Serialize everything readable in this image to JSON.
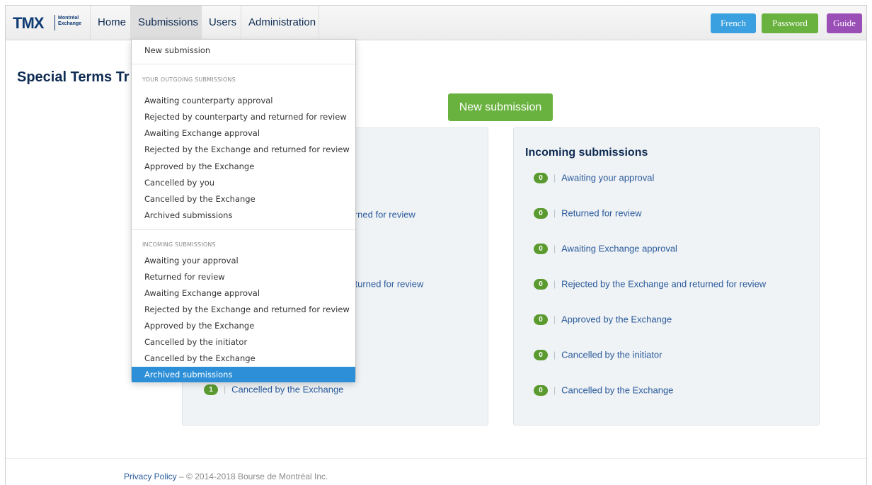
{
  "brand": {
    "logo_text": "TMX",
    "sub_line1": "Montréal",
    "sub_line2": "Exchange"
  },
  "nav": {
    "home": "Home",
    "submissions": "Submissions",
    "users": "Users",
    "administration": "Administration"
  },
  "top_buttons": {
    "french": "French",
    "password": "Password",
    "guide": "Guide"
  },
  "colors": {
    "primary_blue": "#0e2b52",
    "green": "#6ab23f",
    "french": "#3aa0e0",
    "guide": "#9a4fb6",
    "highlight": "#2d8fd8"
  },
  "page": {
    "title": "Special Terms Tr",
    "new_submission_button": "New submission"
  },
  "left_panel": {
    "rows": [
      {
        "label": "turned for review"
      },
      {
        "label": "returned for review"
      },
      {
        "badge": "1",
        "label": "Cancelled by the Exchange"
      }
    ]
  },
  "right_panel": {
    "title": "Incoming submissions",
    "rows": [
      {
        "badge": "0",
        "label": "Awaiting your approval"
      },
      {
        "badge": "0",
        "label": "Returned for review"
      },
      {
        "badge": "0",
        "label": "Awaiting Exchange approval"
      },
      {
        "badge": "0",
        "label": "Rejected by the Exchange and returned for review"
      },
      {
        "badge": "0",
        "label": "Approved by the Exchange"
      },
      {
        "badge": "0",
        "label": "Cancelled by the initiator"
      },
      {
        "badge": "0",
        "label": "Cancelled by the Exchange"
      }
    ]
  },
  "dropdown": {
    "new_submission": "New submission",
    "outgoing_header": "YOUR OUTGOING SUBMISSIONS",
    "outgoing": [
      "Awaiting counterparty approval",
      "Rejected by counterparty and returned for review",
      "Awaiting Exchange approval",
      "Rejected by the Exchange and returned for review",
      "Approved by the Exchange",
      "Cancelled by you",
      "Cancelled by the Exchange",
      "Archived submissions"
    ],
    "incoming_header": "INCOMING SUBMISSIONS",
    "incoming": [
      "Awaiting your approval",
      "Returned for review",
      "Awaiting Exchange approval",
      "Rejected by the Exchange and returned for review",
      "Approved by the Exchange",
      "Cancelled by the initiator",
      "Cancelled by the Exchange",
      "Archived submissions"
    ]
  },
  "footer": {
    "privacy": "Privacy Policy",
    "separator": "–",
    "copyright": "© 2014-2018 Bourse de Montréal Inc."
  }
}
